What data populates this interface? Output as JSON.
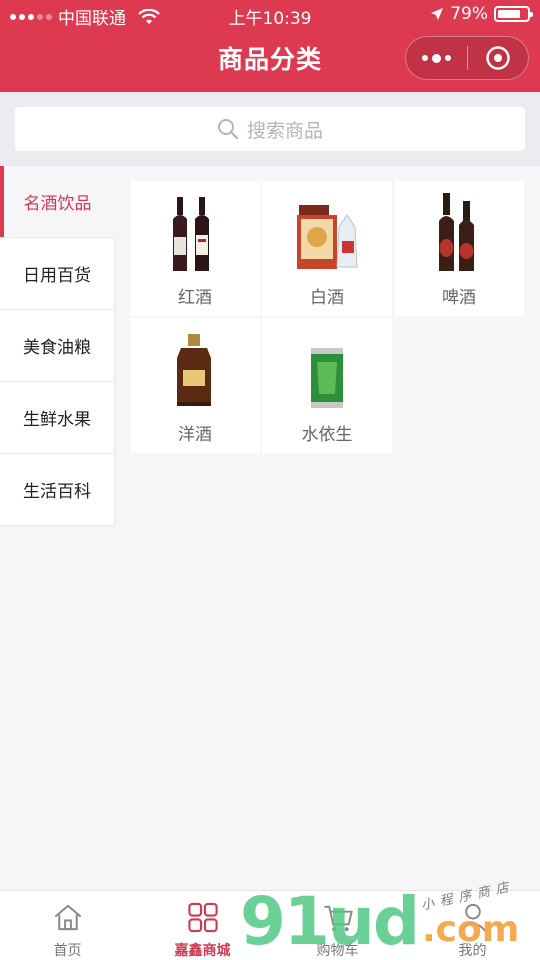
{
  "status_bar": {
    "carrier": "中国联通",
    "time": "上午10:39",
    "battery_percent": "79%",
    "battery_level": 0.79
  },
  "header": {
    "title": "商品分类",
    "color": "#dd3a51"
  },
  "search": {
    "placeholder": "搜索商品"
  },
  "categories": [
    {
      "label": "名酒饮品",
      "active": true
    },
    {
      "label": "日用百货",
      "active": false
    },
    {
      "label": "美食油粮",
      "active": false
    },
    {
      "label": "生鲜水果",
      "active": false
    },
    {
      "label": "生活百科",
      "active": false
    }
  ],
  "products": [
    {
      "label": "红酒",
      "icon": "red-wine-bottles"
    },
    {
      "label": "白酒",
      "icon": "baijiu-gift-box"
    },
    {
      "label": "啤酒",
      "icon": "beer-bottles"
    },
    {
      "label": "洋酒",
      "icon": "whisky-bottle"
    },
    {
      "label": "水依生",
      "icon": "green-drink-can"
    }
  ],
  "tabbar": {
    "items": [
      {
        "label": "首页",
        "icon": "home-icon",
        "active": false
      },
      {
        "label": "嘉鑫商城",
        "icon": "grid-icon",
        "active": true
      },
      {
        "label": "购物车",
        "icon": "cart-icon",
        "active": false
      },
      {
        "label": "我的",
        "icon": "user-icon",
        "active": false
      }
    ]
  },
  "watermark": {
    "logo": "91ud.com",
    "tagline": "小程序商店"
  }
}
